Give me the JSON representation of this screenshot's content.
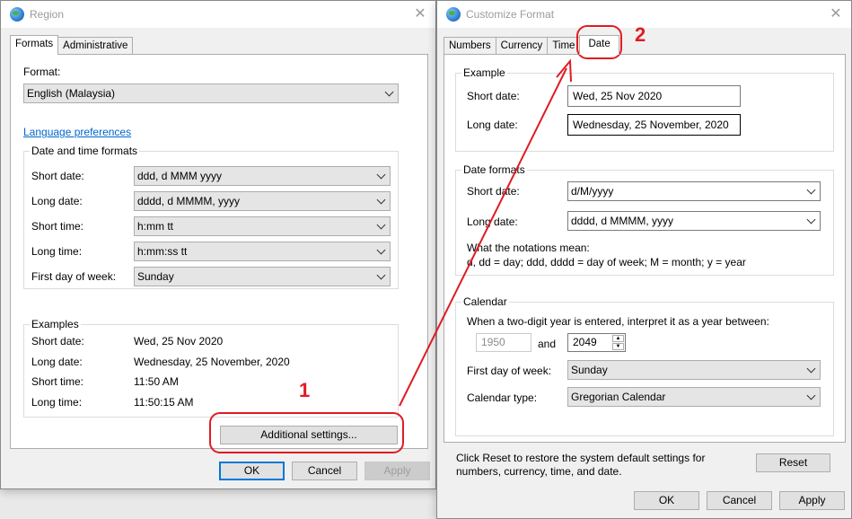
{
  "region": {
    "title": "Region",
    "tabs": [
      "Formats",
      "Administrative"
    ],
    "format_label": "Format:",
    "format_value": "English (Malaysia)",
    "language_link": "Language preferences",
    "dt_group": "Date and time formats",
    "rows": [
      {
        "label": "Short date:",
        "value": "ddd, d MMM yyyy"
      },
      {
        "label": "Long date:",
        "value": "dddd, d MMMM, yyyy"
      },
      {
        "label": "Short time:",
        "value": "h:mm tt"
      },
      {
        "label": "Long time:",
        "value": "h:mm:ss tt"
      },
      {
        "label": "First day of week:",
        "value": "Sunday"
      }
    ],
    "examples_group": "Examples",
    "examples": [
      {
        "label": "Short date:",
        "value": "Wed, 25 Nov 2020"
      },
      {
        "label": "Long date:",
        "value": "Wednesday, 25 November, 2020"
      },
      {
        "label": "Short time:",
        "value": "11:50 AM"
      },
      {
        "label": "Long time:",
        "value": "11:50:15 AM"
      }
    ],
    "additional_btn": "Additional settings...",
    "ok": "OK",
    "cancel": "Cancel",
    "apply": "Apply"
  },
  "custom": {
    "title": "Customize Format",
    "tabs": [
      "Numbers",
      "Currency",
      "Time",
      "Date"
    ],
    "example_group": "Example",
    "short_date_label": "Short date:",
    "short_date_example": "Wed, 25 Nov 2020",
    "long_date_label": "Long date:",
    "long_date_example": "Wednesday, 25 November, 2020",
    "formats_group": "Date formats",
    "short_date_format": "d/M/yyyy",
    "long_date_format": "dddd, d MMMM, yyyy",
    "notation_title": "What the notations mean:",
    "notation_text": "d, dd = day;  ddd, dddd = day of week;  M = month;  y = year",
    "calendar_group": "Calendar",
    "two_digit_text": "When a two-digit year is entered, interpret it as a year between:",
    "year_from": "1950",
    "and_label": "and",
    "year_to": "2049",
    "first_day_label": "First day of week:",
    "first_day_value": "Sunday",
    "cal_type_label": "Calendar type:",
    "cal_type_value": "Gregorian Calendar",
    "reset_text": "Click Reset to restore the system default settings for numbers, currency, time, and date.",
    "reset_btn": "Reset",
    "ok": "OK",
    "cancel": "Cancel",
    "apply": "Apply"
  },
  "annotations": {
    "step1": "1",
    "step2": "2",
    "color": "#e01b24"
  }
}
